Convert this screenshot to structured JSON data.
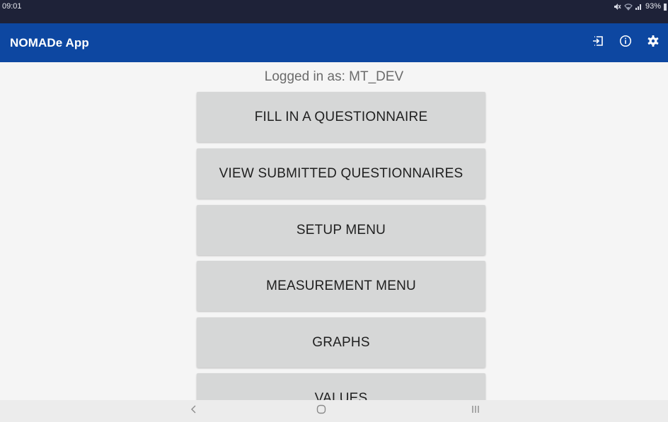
{
  "status_bar": {
    "time": "09:01",
    "battery": "93%",
    "icons": [
      "mute-icon",
      "wifi-icon",
      "signal-icon",
      "battery-icon"
    ]
  },
  "app_bar": {
    "title": "NOMADe App",
    "background": "#0d47a1",
    "actions": [
      "logout-icon",
      "info-icon",
      "settings-gear-icon"
    ]
  },
  "main": {
    "logged_in_text": "Logged in as: MT_DEV",
    "buttons": [
      {
        "label": "FILL IN A QUESTIONNAIRE"
      },
      {
        "label": "VIEW SUBMITTED QUESTIONNAIRES"
      },
      {
        "label": "SETUP MENU"
      },
      {
        "label": "MEASUREMENT MENU"
      },
      {
        "label": "GRAPHS"
      },
      {
        "label": "VALUES"
      }
    ],
    "button_color": "#d6d7d7"
  },
  "nav_bar": {
    "buttons": [
      "back-icon",
      "home-icon",
      "recents-icon"
    ]
  }
}
